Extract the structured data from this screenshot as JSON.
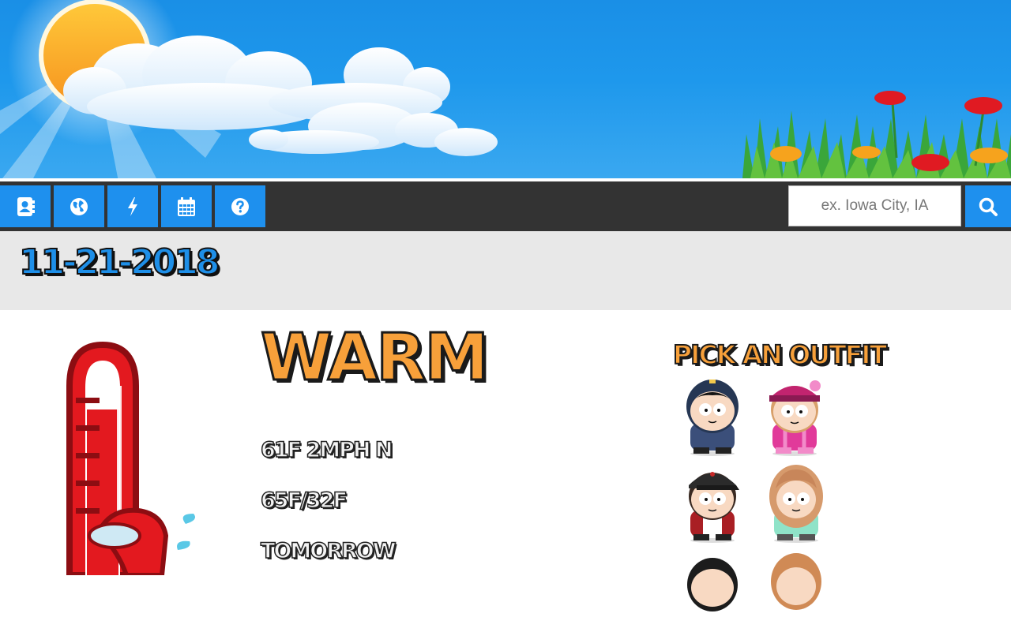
{
  "nav": {
    "buttons": [
      {
        "icon": "address-book-icon"
      },
      {
        "icon": "globe-icon"
      },
      {
        "icon": "bolt-icon"
      },
      {
        "icon": "calendar-icon"
      },
      {
        "icon": "question-circle-icon"
      }
    ],
    "search": {
      "placeholder": "ex. Iowa City, IA",
      "value": ""
    },
    "search_button_icon": "search-icon"
  },
  "date": "11-21-2018",
  "weather": {
    "condition": "WARM",
    "current": "61F 2MPH N",
    "high_low": "65F/32F",
    "next_label": "TOMORROW"
  },
  "outfits": {
    "title": "PICK AN OUTFIT",
    "options": [
      {
        "name": "boy-blue-hoodie"
      },
      {
        "name": "girl-pink-hat"
      },
      {
        "name": "boy-red-cap"
      },
      {
        "name": "girl-curly-hair"
      },
      {
        "name": "boy-dark-hair"
      },
      {
        "name": "girl-ginger-hair"
      }
    ]
  },
  "colors": {
    "accent_blue": "#1e90ee",
    "navbar": "#333333",
    "date_band": "#e8e8e8",
    "orange": "#f7a03a",
    "thermometer_red": "#e3191f"
  }
}
